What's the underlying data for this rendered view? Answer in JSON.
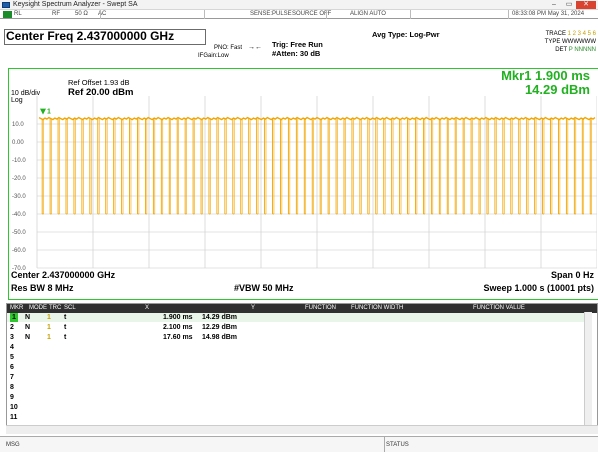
{
  "window": {
    "title": "Keysight Spectrum Analyzer - Swept SA",
    "min": "–",
    "max": "▭",
    "close": "✕"
  },
  "status_row": {
    "rl": "RL",
    "rf": "RF",
    "impedance": "50 Ω",
    "coupling": "AC",
    "sense": "SENSE:PULSE",
    "source": "SOURCE OFF",
    "align": "ALIGN AUTO",
    "datetime": "08:33:08 PM May 31, 2024"
  },
  "header": {
    "center_freq": "Center Freq 2.437000000 GHz",
    "pno": "PNO: Fast",
    "ifgain": "IFGain:Low",
    "trig": "Trig: Free Run",
    "atten": "#Atten: 30 dB",
    "avg_type": "Avg Type: Log-Pwr",
    "trace_label": "TRACE",
    "trace_nums": "1 2 3 4 5 6",
    "type_label": "TYPE",
    "type_vals": "WWWWWW",
    "det_label": "DET",
    "det_vals": "P NNNNN"
  },
  "plot": {
    "ref_offset": "Ref Offset 1.93 dB",
    "ref_level": "Ref 20.00 dBm",
    "scale": "10 dB/div",
    "log": "Log",
    "marker_label": "Mkr1 1.900 ms",
    "marker_value": "14.29 dBm",
    "marker_flag": "1",
    "y_ticks": [
      "10.0",
      "0.00",
      "-10.0",
      "-20.0",
      "-30.0",
      "-40.0",
      "-50.0",
      "-60.0",
      "-70.0"
    ],
    "center": "Center 2.437000000 GHz",
    "res_bw": "Res BW 8 MHz",
    "vbw": "#VBW 50 MHz",
    "span": "Span 0 Hz",
    "sweep": "Sweep  1.000 s (10001 pts)"
  },
  "chart_data": {
    "type": "line",
    "ylabel": "",
    "xlabel": "",
    "ylim": [
      -80,
      20
    ],
    "xlim_ms": [
      0,
      1000
    ],
    "series": [
      {
        "points_ms_dbm": [
          [
            1.9,
            14.29
          ],
          [
            2.1,
            12.29
          ],
          [
            17.6,
            14.98
          ]
        ]
      }
    ],
    "pulse_high_dbm": 13,
    "pulse_low_dbm": -40,
    "pulse_count": 70
  },
  "markers": {
    "columns": [
      "MKR",
      "MODE",
      "TRC",
      "SCL",
      "X",
      "Y",
      "FUNCTION",
      "FUNCTION WIDTH",
      "FUNCTION VALUE"
    ],
    "rows": [
      {
        "mkr": "1",
        "mode": "N",
        "trc": "1",
        "scl": "t",
        "x": "1.900 ms",
        "y": "14.29 dBm"
      },
      {
        "mkr": "2",
        "mode": "N",
        "trc": "1",
        "scl": "t",
        "x": "2.100 ms",
        "y": "12.29 dBm"
      },
      {
        "mkr": "3",
        "mode": "N",
        "trc": "1",
        "scl": "t",
        "x": "17.60 ms",
        "y": "14.98 dBm"
      },
      {
        "mkr": "4"
      },
      {
        "mkr": "5"
      },
      {
        "mkr": "6"
      },
      {
        "mkr": "7"
      },
      {
        "mkr": "8"
      },
      {
        "mkr": "9"
      },
      {
        "mkr": "10"
      },
      {
        "mkr": "11"
      }
    ]
  },
  "bottom": {
    "msg": "MSG",
    "status": "STATUS"
  },
  "colors": {
    "trace": "#f2a500",
    "plot_border": "#2ec82e",
    "marker_text": "#21b121"
  }
}
